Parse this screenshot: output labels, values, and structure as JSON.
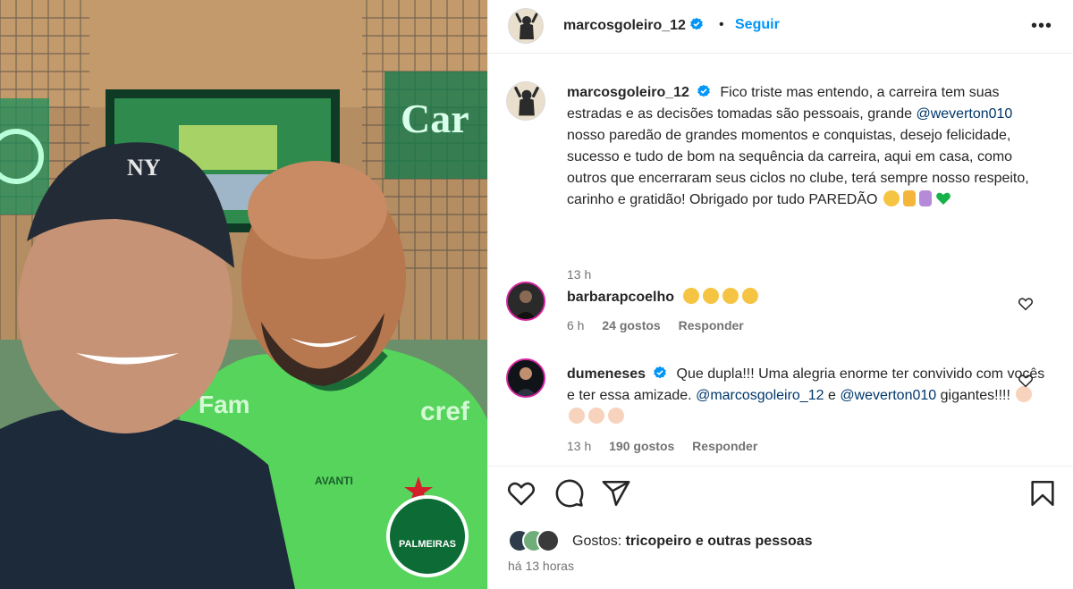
{
  "post": {
    "author": "marcosgoleiro_12",
    "follow_label": "Seguir",
    "dot": "•",
    "more_label": "•••",
    "caption_text_1": "Fico triste mas entendo, a carreira tem suas estradas e as decisões tomadas são pessoais, grande",
    "caption_mention": "@weverton010",
    "caption_text_2": "nosso paredão de grandes momentos e conquistas, desejo felicidade, sucesso e tudo de bom na sequência da carreira, aqui em casa, como outros que encerraram seus ciclos no clube, terá sempre nosso respeito, carinho e gratidão! Obrigado por tudo PAREDÃO",
    "caption_time": "13 h",
    "posted_ago": "há 13 horas"
  },
  "comments": [
    {
      "user": "barbarapcoelho",
      "time": "6 h",
      "likes": "24 gostos",
      "reply": "Responder"
    },
    {
      "user": "dumeneses",
      "text_1": "Que dupla!!! Uma alegria enorme ter convivido com vocês e ter essa amizade.",
      "mention_1": "@marcosgoleiro_12",
      "text_2": "e",
      "mention_2": "@weverton010",
      "text_3": "gigantes!!!!",
      "time": "13 h",
      "likes": "190 gostos",
      "reply": "Responder"
    }
  ],
  "likes_bar": {
    "prefix": "Gostos:",
    "user": "tricopeiro",
    "suffix": "e outras pessoas"
  },
  "photo": {
    "sign_text": "Car",
    "shirt_text_1": "Fam",
    "shirt_text_2": "cref",
    "badge_text": "PALMEIRAS",
    "avanti_text": "AVANTI",
    "cap_logo": "NY"
  },
  "icons": [
    "verified-icon",
    "like-icon",
    "comment-icon",
    "share-icon",
    "save-icon",
    "more-icon"
  ],
  "colors": {
    "link": "#0095f6",
    "mention": "#00376b",
    "muted": "#737373",
    "verified": "#0095f6",
    "palmeiras_green": "#5fd35f"
  }
}
